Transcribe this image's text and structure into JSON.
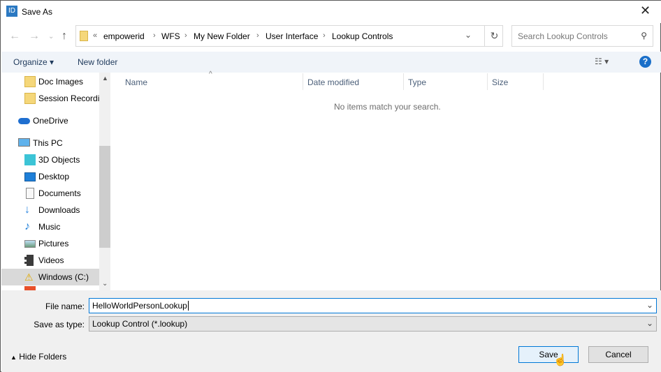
{
  "window": {
    "title": "Save As",
    "app_icon": "ID",
    "close": "✕"
  },
  "address": {
    "overflow": "«",
    "crumbs": [
      "empowerid",
      "WFS",
      "My New Folder",
      "User Interface",
      "Lookup Controls"
    ]
  },
  "search": {
    "placeholder": "Search Lookup Controls"
  },
  "toolbar": {
    "organize": "Organize",
    "new_folder": "New folder",
    "help": "?"
  },
  "sidebar": {
    "items": [
      {
        "label": "Doc Images",
        "icon": "folder-icon"
      },
      {
        "label": "Session Recordir",
        "icon": "folder-icon"
      },
      {
        "label": "OneDrive",
        "icon": "cloud-icon"
      },
      {
        "label": "This PC",
        "icon": "computer-icon"
      },
      {
        "label": "3D Objects",
        "icon": "cube-icon"
      },
      {
        "label": "Desktop",
        "icon": "desktop-icon"
      },
      {
        "label": "Documents",
        "icon": "document-icon"
      },
      {
        "label": "Downloads",
        "icon": "download-icon"
      },
      {
        "label": "Music",
        "icon": "music-icon"
      },
      {
        "label": "Pictures",
        "icon": "picture-icon"
      },
      {
        "label": "Videos",
        "icon": "video-icon"
      },
      {
        "label": "Windows (C:)",
        "icon": "drive-icon"
      }
    ]
  },
  "columns": [
    "Name",
    "Date modified",
    "Type",
    "Size"
  ],
  "empty_message": "No items match your search.",
  "form": {
    "file_name_label": "File name:",
    "file_name_value": "HelloWorldPersonLookup",
    "type_label": "Save as type:",
    "type_value": "Lookup Control (*.lookup)"
  },
  "buttons": {
    "hide_folders": "Hide Folders",
    "save": "Save",
    "cancel": "Cancel"
  }
}
